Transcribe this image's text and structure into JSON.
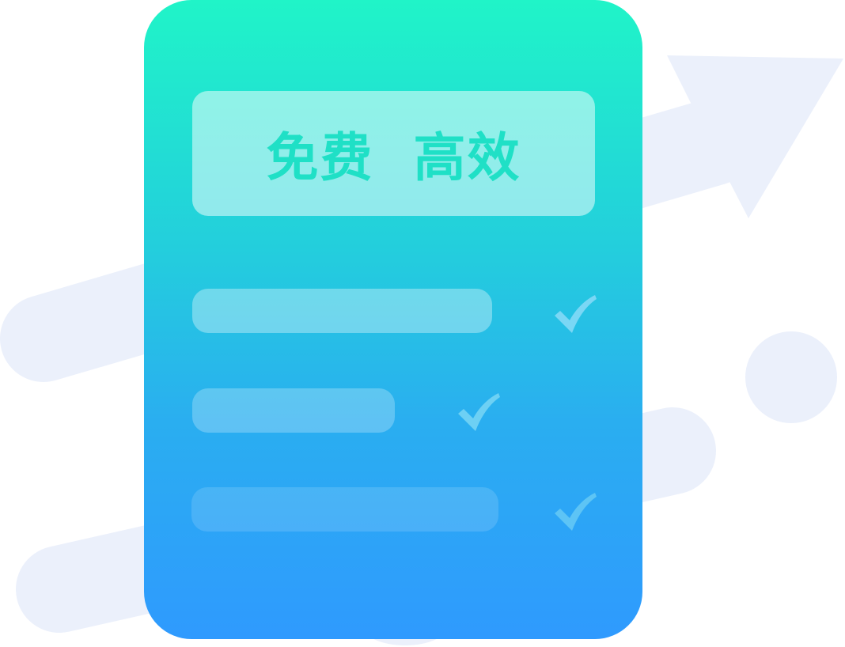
{
  "banner": {
    "title": "免费  高效"
  },
  "checklist": {
    "items": [
      {
        "checked": true
      },
      {
        "checked": true
      },
      {
        "checked": true
      }
    ]
  },
  "colors": {
    "card_top": "#20f4c8",
    "card_bottom": "#2f9afe",
    "title_text": "#1fe0c6",
    "background_shapes": "#ebf0fb",
    "check_mark": "#7ed8f5"
  },
  "icons": {
    "background": [
      "trend-arrow-icon",
      "circle-dot-icon"
    ],
    "checklist": "check-icon"
  }
}
